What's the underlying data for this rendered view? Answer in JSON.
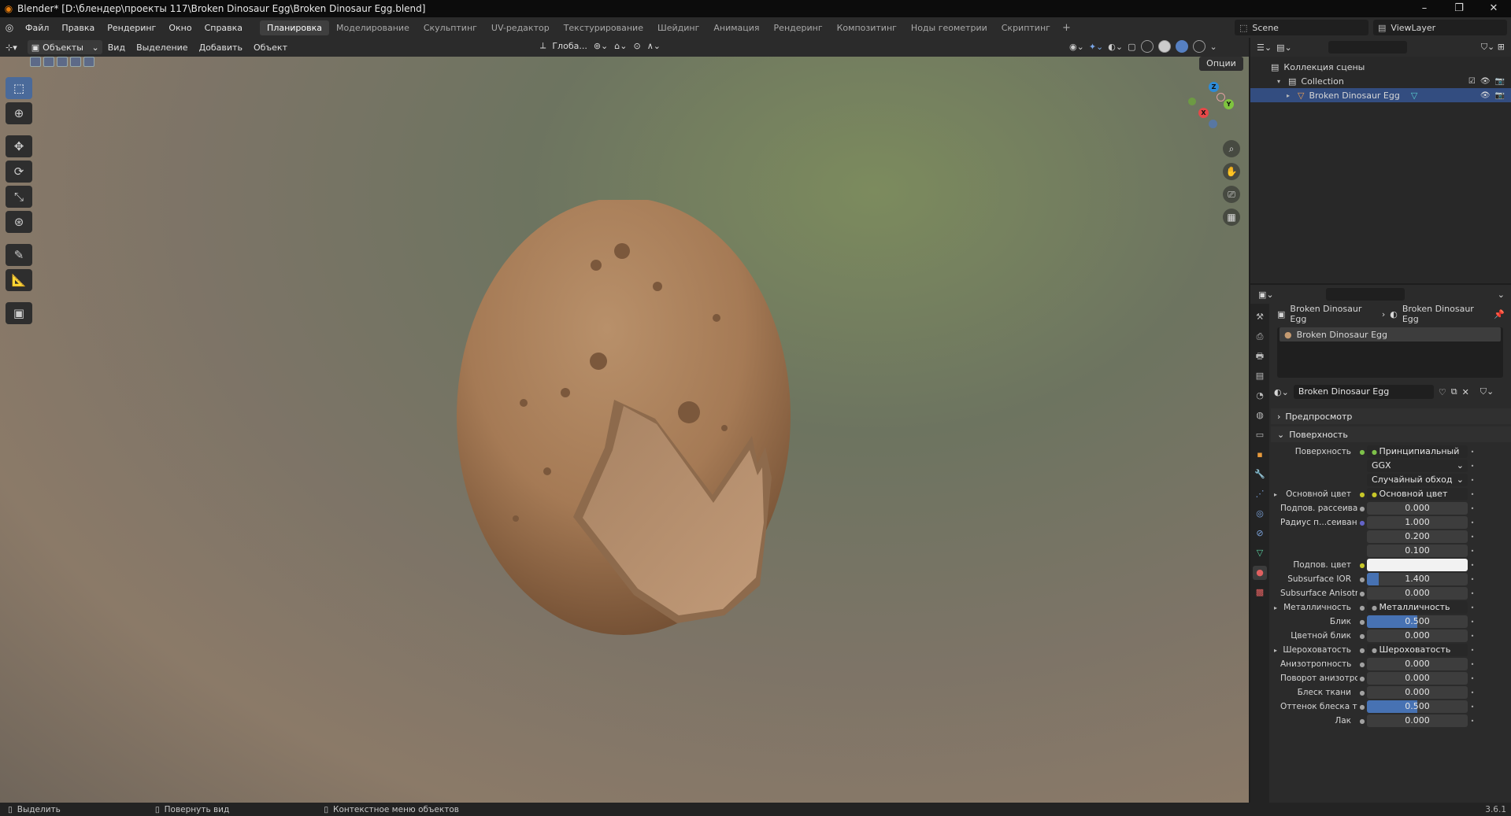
{
  "titlebar": {
    "title": "Blender* [D:\\блендер\\проекты 117\\Broken Dinosaur Egg\\Broken Dinosaur Egg.blend]",
    "minimize": "–",
    "maximize": "❐",
    "close": "✕"
  },
  "menu": {
    "items": [
      "Файл",
      "Правка",
      "Рендеринг",
      "Окно",
      "Справка"
    ],
    "workspaces": [
      "Планировка",
      "Моделирование",
      "Скульптинг",
      "UV-редактор",
      "Текстурирование",
      "Шейдинг",
      "Анимация",
      "Рендеринг",
      "Композитинг",
      "Ноды геометрии",
      "Скриптинг"
    ],
    "active_workspace": 0,
    "add_workspace": "+",
    "scene": "Scene",
    "view_layer": "ViewLayer"
  },
  "viewport_header": {
    "mode": "Объекты",
    "menus": [
      "Вид",
      "Выделение",
      "Добавить",
      "Объект"
    ],
    "orientation": "Глоба...",
    "options": "Опции"
  },
  "gizmo": {
    "z": "Z",
    "x": "X",
    "y": "Y"
  },
  "outliner": {
    "scene_collection": "Коллекция сцены",
    "collection": "Collection",
    "object": "Broken Dinosaur Egg"
  },
  "properties": {
    "breadcrumb_object": "Broken Dinosaur Egg",
    "breadcrumb_material": "Broken Dinosaur Egg",
    "slot": "Broken Dinosaur Egg",
    "material_name": "Broken Dinosaur Egg",
    "panel_preview": "Предпросмотр",
    "panel_surface": "Поверхность",
    "rows": [
      {
        "label": "Поверхность",
        "value": "Принципиальный BSDF",
        "kind": "link",
        "dot": "#7ec14a"
      },
      {
        "label": "",
        "value": "GGX",
        "kind": "drop"
      },
      {
        "label": "",
        "value": "Случайный обход",
        "kind": "drop"
      },
      {
        "label": "Основной цвет",
        "value": "Основной цвет",
        "kind": "link",
        "dot": "#c7c729",
        "arrow": "▸"
      },
      {
        "label": "Подпов. рассеива...",
        "value": "0.000",
        "kind": "num",
        "dot": "#a1a1a1"
      },
      {
        "label": "Радиус п...сеивания",
        "value": "1.000",
        "kind": "num",
        "dot": "#6363c7"
      },
      {
        "label": "",
        "value": "0.200",
        "kind": "num"
      },
      {
        "label": "",
        "value": "0.100",
        "kind": "num"
      },
      {
        "label": "Подпов. цвет",
        "value": "",
        "kind": "white",
        "dot": "#c7c729"
      },
      {
        "label": "Subsurface IOR",
        "value": "1.400",
        "kind": "num",
        "dot": "#a1a1a1",
        "fill": 0.12
      },
      {
        "label": "Subsurface Anisotr...",
        "value": "0.000",
        "kind": "num",
        "dot": "#a1a1a1"
      },
      {
        "label": "Металличность",
        "value": "Металличность",
        "kind": "link",
        "dot": "#a1a1a1",
        "arrow": "▸"
      },
      {
        "label": "Блик",
        "value": "0.500",
        "kind": "num",
        "dot": "#a1a1a1",
        "fill": 0.5
      },
      {
        "label": "Цветной блик",
        "value": "0.000",
        "kind": "num",
        "dot": "#a1a1a1"
      },
      {
        "label": "Шероховатость",
        "value": "Шероховатость",
        "kind": "link",
        "dot": "#a1a1a1",
        "arrow": "▸"
      },
      {
        "label": "Анизотропность",
        "value": "0.000",
        "kind": "num",
        "dot": "#a1a1a1"
      },
      {
        "label": "Поворот анизотро...",
        "value": "0.000",
        "kind": "num",
        "dot": "#a1a1a1"
      },
      {
        "label": "Блеск ткани",
        "value": "0.000",
        "kind": "num",
        "dot": "#a1a1a1"
      },
      {
        "label": "Оттенок блеска тк...",
        "value": "0.500",
        "kind": "num",
        "dot": "#a1a1a1",
        "fill": 0.5
      },
      {
        "label": "Лак",
        "value": "0.000",
        "kind": "num",
        "dot": "#a1a1a1"
      }
    ]
  },
  "statusbar": {
    "select": "Выделить",
    "rotate_view": "Повернуть вид",
    "context_menu": "Контекстное меню объектов",
    "version": "3.6.1"
  },
  "colors": {
    "accent": "#4772b3",
    "selected_row": "#334d80",
    "egg": "#a57a55"
  }
}
